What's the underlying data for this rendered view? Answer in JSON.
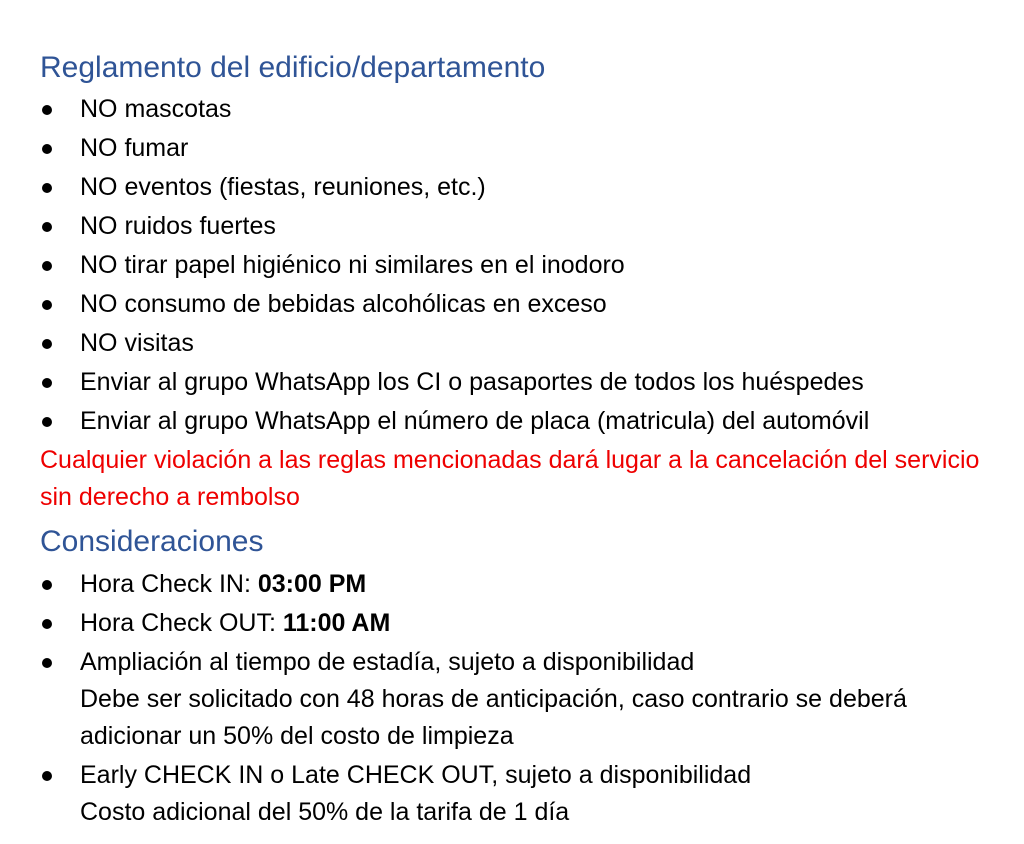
{
  "section1": {
    "title": "Reglamento del edificio/departamento",
    "rules": [
      "NO mascotas",
      "NO fumar",
      "NO eventos (fiestas, reuniones, etc.)",
      "NO ruidos fuertes",
      "NO tirar papel higiénico ni similares en el inodoro",
      "NO consumo de bebidas alcohólicas en exceso",
      "NO visitas",
      "Enviar al grupo WhatsApp los CI o pasaportes de todos los huéspedes",
      "Enviar al grupo WhatsApp el número de placa (matricula) del automóvil"
    ],
    "warning": "Cualquier violación a las reglas mencionadas dará lugar a la cancelación del servicio sin derecho a rembolso"
  },
  "section2": {
    "title": "Consideraciones",
    "checkin": {
      "label": "Hora Check IN: ",
      "value": "03:00 PM"
    },
    "checkout": {
      "label": "Hora Check OUT: ",
      "value": "11:00 AM"
    },
    "extension": {
      "line1": "Ampliación al tiempo de estadía, sujeto a disponibilidad",
      "line2": "Debe ser solicitado con 48 horas de anticipación, caso contrario se deberá adicionar un 50% del costo de limpieza"
    },
    "early_late": {
      "line1": "Early CHECK IN o Late CHECK OUT, sujeto a disponibilidad",
      "line2": "Costo adicional del 50% de la tarifa de 1 día"
    }
  },
  "colors": {
    "heading": "#2f5496",
    "warning": "#ee0000",
    "text": "#000000"
  }
}
